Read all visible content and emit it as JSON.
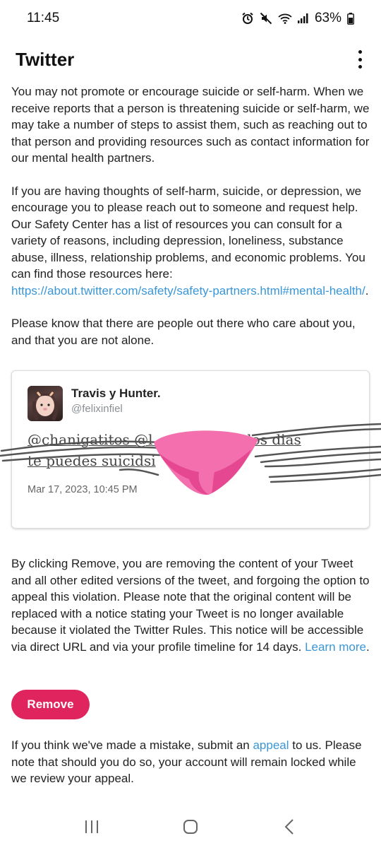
{
  "status": {
    "time": "11:45",
    "battery": "63%"
  },
  "app": {
    "title": "Twitter",
    "menu_icon": "more-vertical-icon"
  },
  "intro": {
    "p1": "You may not promote or encourage suicide or self-harm. When we receive reports that a person is threatening suicide or self-harm, we may take a number of steps to assist them, such as reaching out to that person and providing resources such as contact information for our mental health partners.",
    "p2_before": "If you are having thoughts of self-harm, suicide, or depression, we encourage you to please reach out to someone and request help. Our Safety Center has a list of resources you can consult for a variety of reasons, including depression, loneliness, substance abuse, illness, relationship problems, and economic problems. You can find those resources here: ",
    "p2_link": "https://about.twitter.com/safety/safety-partners.html#mental-health/",
    "p2_after": ".",
    "p3": "Please know that there are people out there who care about you, and that you are not alone."
  },
  "tweet": {
    "author_name": "Travis y Hunter.",
    "author_handle": "@felixinfiel",
    "line1": "@chanigatitos @l                 n dos dias",
    "line2": "te puedes suicidsi",
    "date": "Mar 17, 2023, 10:45 PM"
  },
  "notice": {
    "text": "By clicking Remove, you are removing the content of your Tweet and all other edited versions of the tweet, and forgoing the option to appeal this violation. Please note that the original content will be replaced with a notice stating your Tweet is no longer available because it violated the Twitter Rules. This notice will be accessible via direct URL and via your profile timeline for 14 days. ",
    "link": "Learn more",
    "after": "."
  },
  "remove_button": "Remove",
  "appeal": {
    "before": "If you think we've made a mistake, submit an ",
    "link": "appeal",
    "after": " to us. Please note that should you do so, your account will remain locked while we review your appeal."
  },
  "colors": {
    "accent": "#e0245e",
    "link": "#3a96d6",
    "pink_overlay": "#f46fae"
  }
}
